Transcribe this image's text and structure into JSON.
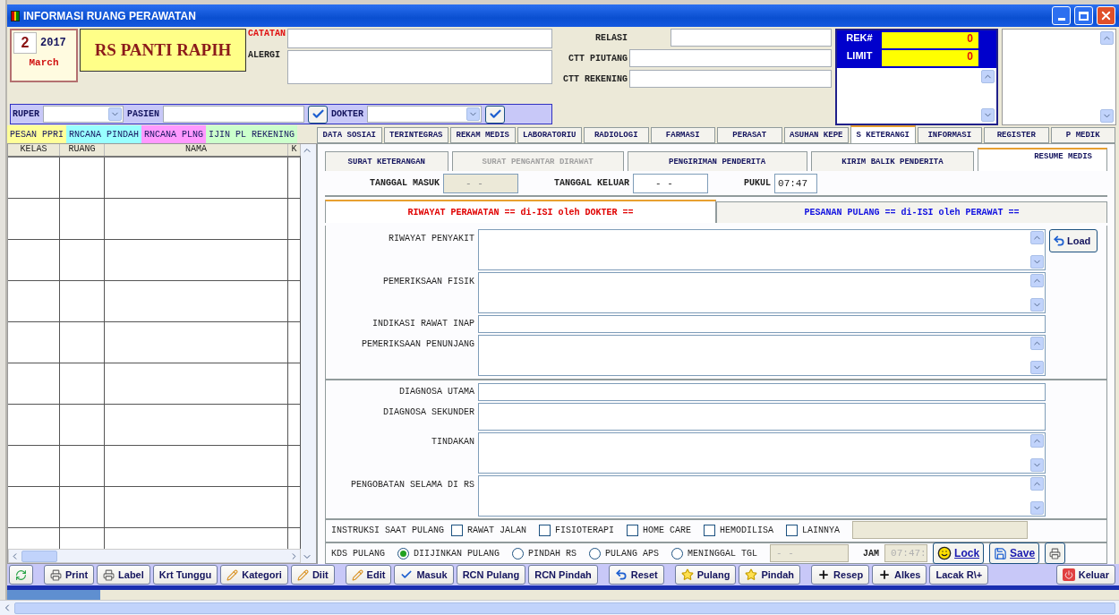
{
  "window": {
    "title": "INFORMASI RUANG PERAWATAN"
  },
  "date": {
    "day": "2",
    "year": "2017",
    "month": "March"
  },
  "hospital": "RS PANTI RAPIH",
  "notes": [
    {
      "label": "CATATAN",
      "kind": "alert"
    },
    {
      "label": "ALERGI",
      "kind": "normal"
    }
  ],
  "relations": [
    {
      "label": "RELASI",
      "kind": "short"
    },
    {
      "label": "CTT PIUTANG",
      "kind": "long"
    },
    {
      "label": "CTT REKENING",
      "kind": "long"
    }
  ],
  "account": [
    {
      "label": "REK#",
      "value": "0"
    },
    {
      "label": "LIMIT",
      "value": "0"
    }
  ],
  "filters": [
    {
      "label": "RUPER",
      "kind": "combo"
    },
    {
      "label": "PASIEN",
      "kind": "search"
    },
    {
      "label": "DOKTER",
      "kind": "combo_check"
    }
  ],
  "ward_tabs": [
    {
      "label": "PESAN PPRI",
      "color": "#ffff99"
    },
    {
      "label": "RNCANA PINDAH",
      "color": "#99ffff"
    },
    {
      "label": "RNCANA PLNG",
      "color": "#ff99ff"
    },
    {
      "label": "IJIN PL REKENING",
      "color": "#ccffcc"
    }
  ],
  "ward_table": {
    "columns": [
      "KELAS",
      "RUANG",
      "NAMA",
      "K"
    ]
  },
  "tabs": [
    {
      "label": "DATA SOSIAI",
      "selected": false
    },
    {
      "label": "TERINTEGRAS",
      "selected": false
    },
    {
      "label": "REKAM MEDIS",
      "selected": false
    },
    {
      "label": "LABORATORIU",
      "selected": false
    },
    {
      "label": "RADIOLOGI",
      "selected": false
    },
    {
      "label": "FARMASI",
      "selected": false
    },
    {
      "label": "PERASAT",
      "selected": false
    },
    {
      "label": "ASUHAN KEPE",
      "selected": false
    },
    {
      "label": "S KETERANGI",
      "selected": true
    },
    {
      "label": "INFORMASI",
      "selected": false
    },
    {
      "label": "REGISTER",
      "selected": false
    },
    {
      "label": "P MEDIK",
      "selected": false
    }
  ],
  "sub_tabs": [
    {
      "label": "SURAT KETERANGAN",
      "selected": false,
      "disabled": false
    },
    {
      "label": "SURAT PENGANTAR DIRAWAT",
      "selected": false,
      "disabled": true
    },
    {
      "label": "PENGIRIMAN PENDERITA",
      "selected": false,
      "disabled": false
    },
    {
      "label": "KIRIM BALIK PENDERITA",
      "selected": false,
      "disabled": false
    },
    {
      "label": "RESUME MEDIS",
      "selected": true,
      "disabled": false
    }
  ],
  "dates": [
    {
      "label": "TANGGAL MASUK",
      "value": "- -",
      "disabled": true
    },
    {
      "label": "TANGGAL KELUAR",
      "value": "- -",
      "disabled": false
    },
    {
      "label": "PUKUL",
      "value": "07:47",
      "disabled": false
    }
  ],
  "section_tabs": [
    {
      "label": "RIWAYAT PERAWATAN == di-ISI oleh DOKTER ==",
      "selected": true
    },
    {
      "label": "PESANAN PULANG == di-ISI oleh PERAWAT ==",
      "selected": false
    }
  ],
  "load_button": "Load",
  "history_fields": [
    {
      "label": "RIWAYAT PENYAKIT",
      "kind": "memo"
    },
    {
      "label": "PEMERIKSAAN FISIK",
      "kind": "memo"
    },
    {
      "label": "INDIKASI RAWAT INAP",
      "kind": "line"
    },
    {
      "label": "PEMERIKSAAN PENUNJANG",
      "kind": "memo"
    }
  ],
  "diagnosis_fields": [
    {
      "label": "DIAGNOSA UTAMA",
      "kind": "line"
    },
    {
      "label": "DIAGNOSA SEKUNDER",
      "kind": "box"
    },
    {
      "label": "TINDAKAN",
      "kind": "memo"
    },
    {
      "label": "PENGOBATAN SELAMA DI RS",
      "kind": "memo"
    }
  ],
  "instructions": {
    "label": "INSTRUKSI SAAT PULANG",
    "options": [
      {
        "label": "RAWAT JALAN",
        "checked": false
      },
      {
        "label": "FISIOTERAPI",
        "checked": false
      },
      {
        "label": "HOME CARE",
        "checked": false
      },
      {
        "label": "HEMODILISA",
        "checked": false
      },
      {
        "label": "LAINNYA",
        "checked": false
      }
    ]
  },
  "discharge": {
    "label": "KDS PULANG",
    "options": [
      {
        "label": "DIIJINKAN PULANG",
        "selected": true
      },
      {
        "label": "PINDAH RS",
        "selected": false
      },
      {
        "label": "PULANG APS",
        "selected": false
      },
      {
        "label": "MENINGGAL TGL",
        "selected": false
      }
    ],
    "date_value": "- -",
    "time_label": "JAM",
    "time_value": "07:47:"
  },
  "form_buttons": [
    {
      "label": "Lock",
      "kind": "smiley"
    },
    {
      "label": "Save",
      "kind": "disk"
    },
    {
      "kind": "printer"
    }
  ],
  "toolbar": [
    [
      {
        "kind": "refresh"
      }
    ],
    [
      {
        "label": "Print",
        "kind": "printer"
      },
      {
        "label": "Label",
        "kind": "printer"
      },
      {
        "label": "Krt Tunggu",
        "kind": "plain"
      },
      {
        "label": "Kategori",
        "kind": "pencil"
      },
      {
        "label": "Diit",
        "kind": "pencil"
      }
    ],
    [
      {
        "label": "Edit",
        "kind": "pencil"
      },
      {
        "label": "Masuk",
        "kind": "check"
      },
      {
        "label": "RCN Pulang",
        "kind": "plain"
      },
      {
        "label": "RCN Pindah",
        "kind": "plain"
      }
    ],
    [
      {
        "label": "Reset",
        "kind": "undo"
      }
    ],
    [
      {
        "label": "Pulang",
        "kind": "star"
      },
      {
        "label": "Pindah",
        "kind": "star"
      }
    ],
    [
      {
        "label": "Resep",
        "kind": "plus"
      },
      {
        "label": "Alkes",
        "kind": "plus"
      },
      {
        "label": "Lacak R\\+",
        "kind": "plain"
      }
    ]
  ],
  "exit_button": {
    "label": "Keluar",
    "kind": "power"
  }
}
